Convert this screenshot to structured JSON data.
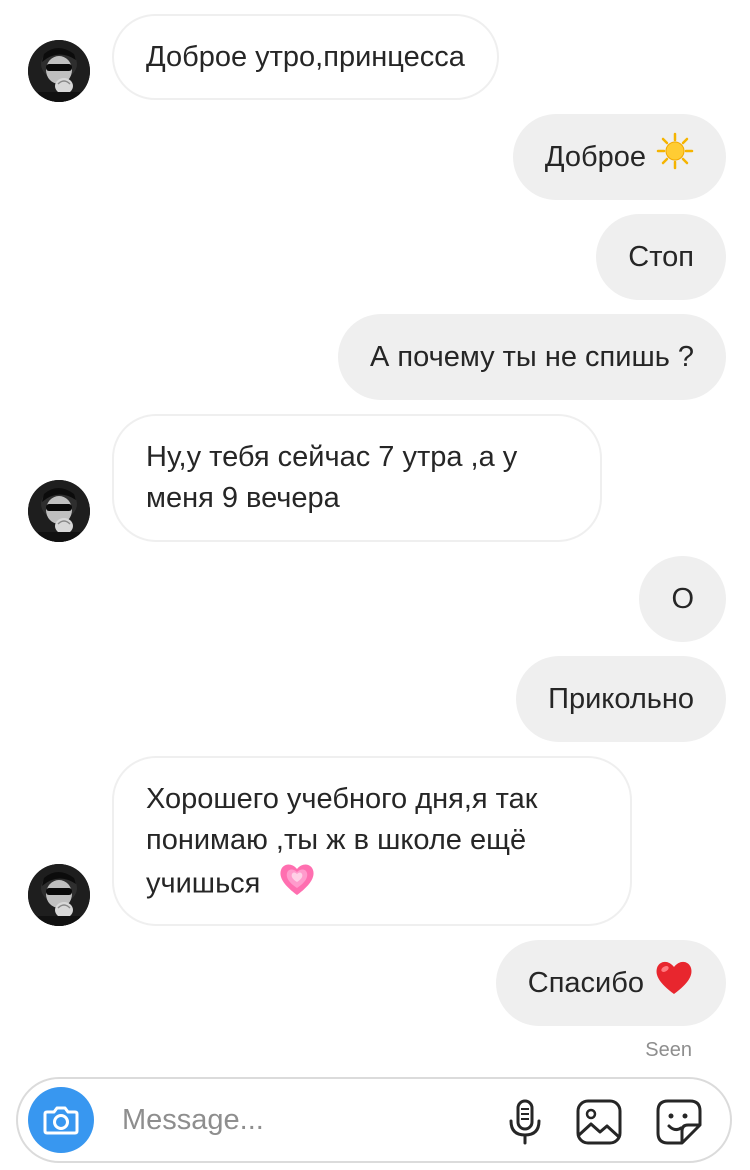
{
  "conversation": {
    "messages": [
      {
        "from": "them",
        "text": "Доброе утро,принцесса"
      },
      {
        "from": "me",
        "text": "Доброе",
        "emoji": "sun-emoji"
      },
      {
        "from": "me",
        "text": "Стоп"
      },
      {
        "from": "me",
        "text": "А почему ты не спишь ?"
      },
      {
        "from": "them",
        "lines": [
          "Ну,у тебя сейчас 7 утра ,а у",
          "меня 9 вечера"
        ]
      },
      {
        "from": "me",
        "text": "О"
      },
      {
        "from": "me",
        "text": "Прикольно"
      },
      {
        "from": "them",
        "lines": [
          "Хорошего учебного дня,я так",
          "понимаю ,ты ж в школе ещё",
          "учишься"
        ],
        "emoji": "growing-heart-emoji"
      },
      {
        "from": "me",
        "text": "Спасибо",
        "emoji": "red-heart-emoji"
      }
    ],
    "seen_label": "Seen"
  },
  "composer": {
    "placeholder": "Message...",
    "icons": [
      "camera-icon",
      "microphone-icon",
      "gallery-icon",
      "sticker-icon"
    ]
  },
  "colors": {
    "outgoing_bubble": "#efefef",
    "incoming_border": "#efefef",
    "camera_button": "#3897f0",
    "text": "#262626",
    "muted": "#8e8e8e"
  }
}
